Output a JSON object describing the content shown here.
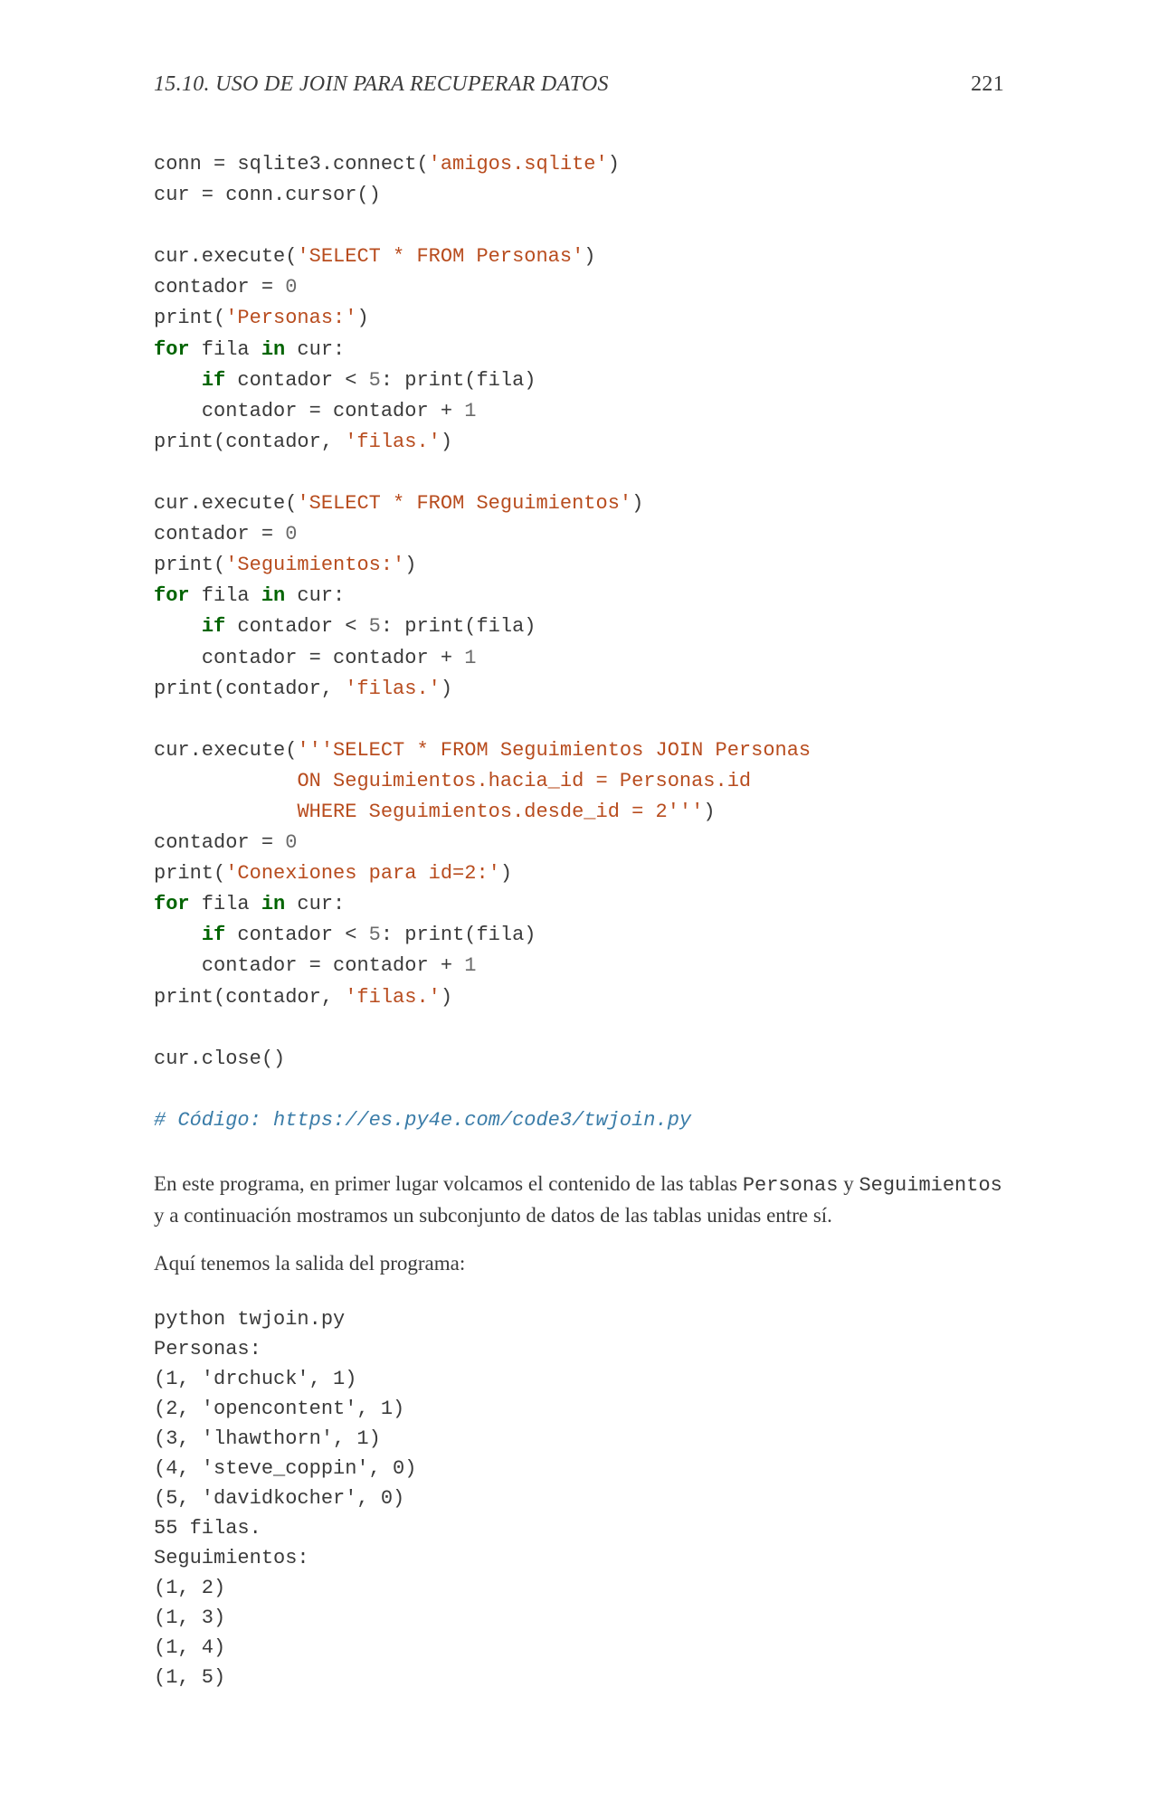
{
  "header": {
    "section": "15.10.  USO DE JOIN PARA RECUPERAR DATOS",
    "page": "221"
  },
  "code": {
    "l1_a": "conn = sqlite3.connect(",
    "l1_str": "'amigos.sqlite'",
    "l1_b": ")",
    "l2": "cur = conn.cursor()",
    "l3_a": "cur.execute(",
    "l3_str": "'SELECT * FROM Personas'",
    "l3_b": ")",
    "l4_a": "contador = ",
    "l4_num": "0",
    "l5_a": "print(",
    "l5_str": "'Personas:'",
    "l5_b": ")",
    "l6_kw1": "for",
    "l6_mid": " fila ",
    "l6_kw2": "in",
    "l6_end": " cur:",
    "l7_pad": "    ",
    "l7_kw": "if",
    "l7_a": " contador < ",
    "l7_num": "5",
    "l7_b": ": print(fila)",
    "l8_pad": "    ",
    "l8_a": "contador = contador + ",
    "l8_num": "1",
    "l9_a": "print(contador, ",
    "l9_str": "'filas.'",
    "l9_b": ")",
    "l10_a": "cur.execute(",
    "l10_str": "'SELECT * FROM Seguimientos'",
    "l10_b": ")",
    "l11_a": "contador = ",
    "l11_num": "0",
    "l12_a": "print(",
    "l12_str": "'Seguimientos:'",
    "l12_b": ")",
    "l13_kw1": "for",
    "l13_mid": " fila ",
    "l13_kw2": "in",
    "l13_end": " cur:",
    "l14_pad": "    ",
    "l14_kw": "if",
    "l14_a": " contador < ",
    "l14_num": "5",
    "l14_b": ": print(fila)",
    "l15_pad": "    ",
    "l15_a": "contador = contador + ",
    "l15_num": "1",
    "l16_a": "print(contador, ",
    "l16_str": "'filas.'",
    "l16_b": ")",
    "l17_a": "cur.execute(",
    "l17_str": "'''SELECT * FROM Seguimientos JOIN Personas",
    "l18_pad": "            ",
    "l18_str": "ON Seguimientos.hacia_id = Personas.id",
    "l19_pad": "            ",
    "l19_str": "WHERE Seguimientos.desde_id = 2'''",
    "l19_b": ")",
    "l20_a": "contador = ",
    "l20_num": "0",
    "l21_a": "print(",
    "l21_str": "'Conexiones para id=2:'",
    "l21_b": ")",
    "l22_kw1": "for",
    "l22_mid": " fila ",
    "l22_kw2": "in",
    "l22_end": " cur:",
    "l23_pad": "    ",
    "l23_kw": "if",
    "l23_a": " contador < ",
    "l23_num": "5",
    "l23_b": ": print(fila)",
    "l24_pad": "    ",
    "l24_a": "contador = contador + ",
    "l24_num": "1",
    "l25_a": "print(contador, ",
    "l25_str": "'filas.'",
    "l25_b": ")",
    "l26": "cur.close()",
    "l27_comment": "# Código: https://es.py4e.com/code3/twjoin.py"
  },
  "para1": {
    "t1": "En este programa, en primer lugar volcamos el contenido de las tablas ",
    "m1": "Personas",
    "t2": " y ",
    "m2": "Seguimientos",
    "t3": " y a continuación mostramos un subconjunto de datos de las tablas unidas entre sí."
  },
  "para2": "Aquí tenemos la salida del programa:",
  "output": {
    "l1": "python twjoin.py",
    "l2": "Personas:",
    "l3": "(1, 'drchuck', 1)",
    "l4": "(2, 'opencontent', 1)",
    "l5": "(3, 'lhawthorn', 1)",
    "l6": "(4, 'steve_coppin', 0)",
    "l7": "(5, 'davidkocher', 0)",
    "l8": "55 filas.",
    "l9": "Seguimientos:",
    "l10": "(1, 2)",
    "l11": "(1, 3)",
    "l12": "(1, 4)",
    "l13": "(1, 5)"
  }
}
